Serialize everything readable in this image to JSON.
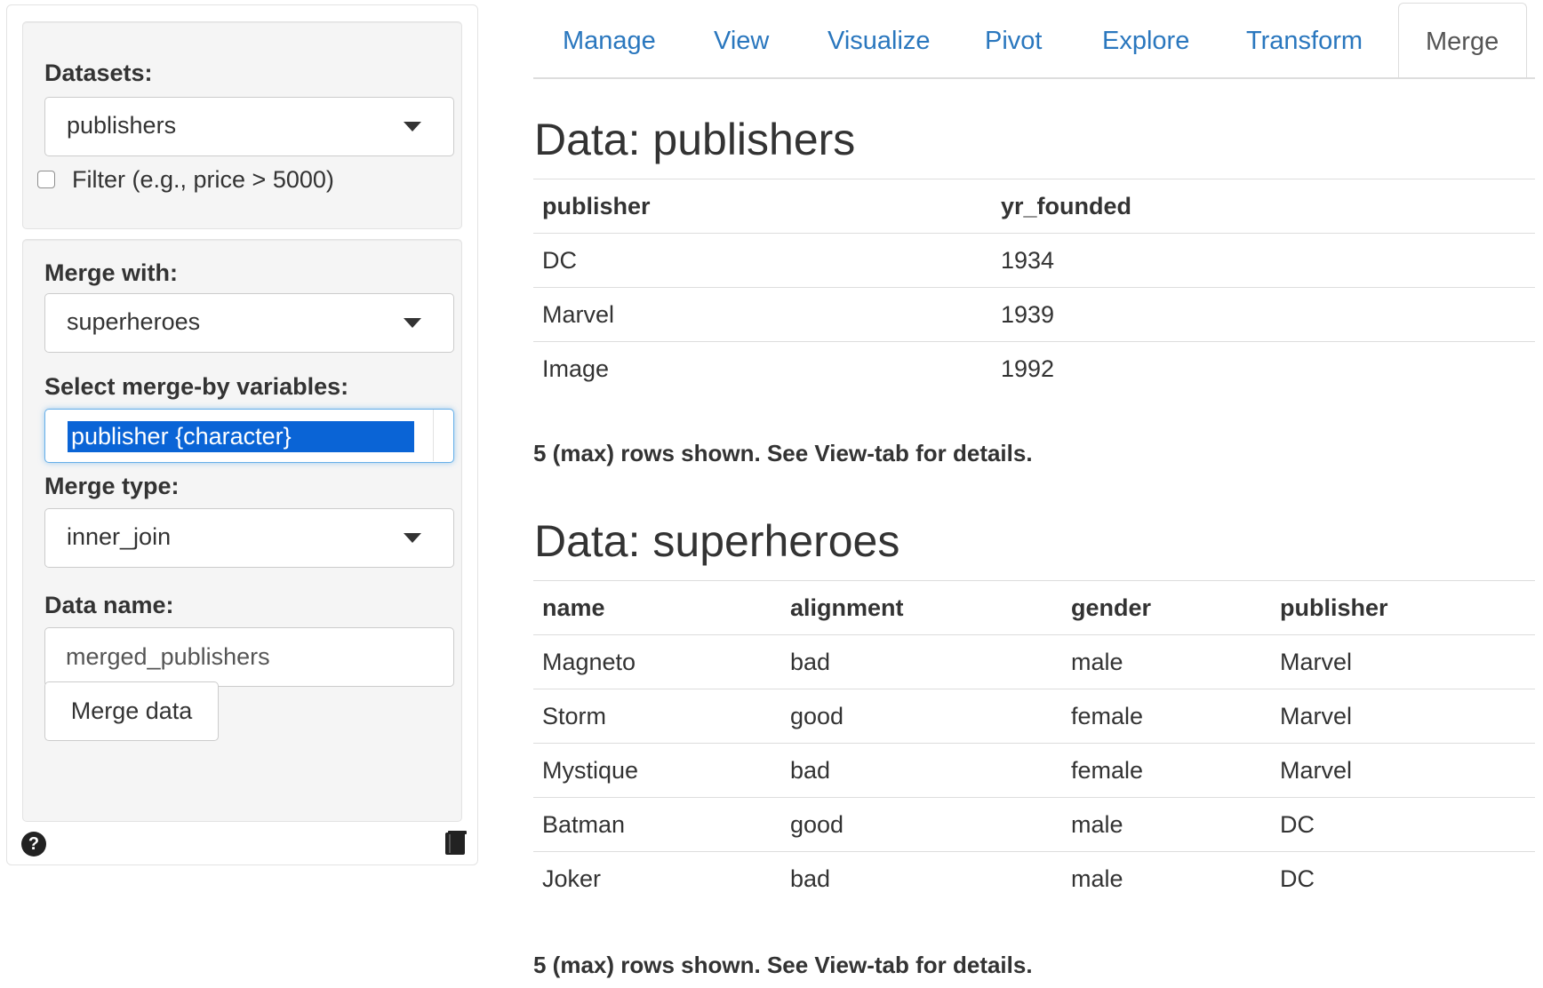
{
  "sidebar": {
    "datasets_label": "Datasets:",
    "datasets_value": "publishers",
    "filter_label": "Filter (e.g., price > 5000)",
    "merge_with_label": "Merge with:",
    "merge_with_value": "superheroes",
    "merge_by_label": "Select merge-by variables:",
    "merge_by_selected": "publisher {character}",
    "merge_type_label": "Merge type:",
    "merge_type_value": "inner_join",
    "data_name_label": "Data name:",
    "data_name_value": "merged_publishers",
    "merge_button": "Merge data",
    "help_icon_glyph": "?"
  },
  "tabs": {
    "items": [
      "Manage",
      "View",
      "Visualize",
      "Pivot",
      "Explore",
      "Transform",
      "Merge"
    ],
    "active": "Merge"
  },
  "main": {
    "table1": {
      "heading": "Data: publishers",
      "columns": [
        "publisher",
        "yr_founded"
      ],
      "rows": [
        [
          "DC",
          "1934"
        ],
        [
          "Marvel",
          "1939"
        ],
        [
          "Image",
          "1992"
        ]
      ],
      "note": "5 (max) rows shown. See View-tab for details."
    },
    "table2": {
      "heading": "Data: superheroes",
      "columns": [
        "name",
        "alignment",
        "gender",
        "publisher"
      ],
      "rows": [
        [
          "Magneto",
          "bad",
          "male",
          "Marvel"
        ],
        [
          "Storm",
          "good",
          "female",
          "Marvel"
        ],
        [
          "Mystique",
          "bad",
          "female",
          "Marvel"
        ],
        [
          "Batman",
          "good",
          "male",
          "DC"
        ],
        [
          "Joker",
          "bad",
          "male",
          "DC"
        ]
      ],
      "note": "5 (max) rows shown. See View-tab for details."
    }
  },
  "colors": {
    "link": "#2a77be",
    "selection": "#0a64d6",
    "focus_border": "#66afe9",
    "well_bg": "#f5f5f5"
  }
}
